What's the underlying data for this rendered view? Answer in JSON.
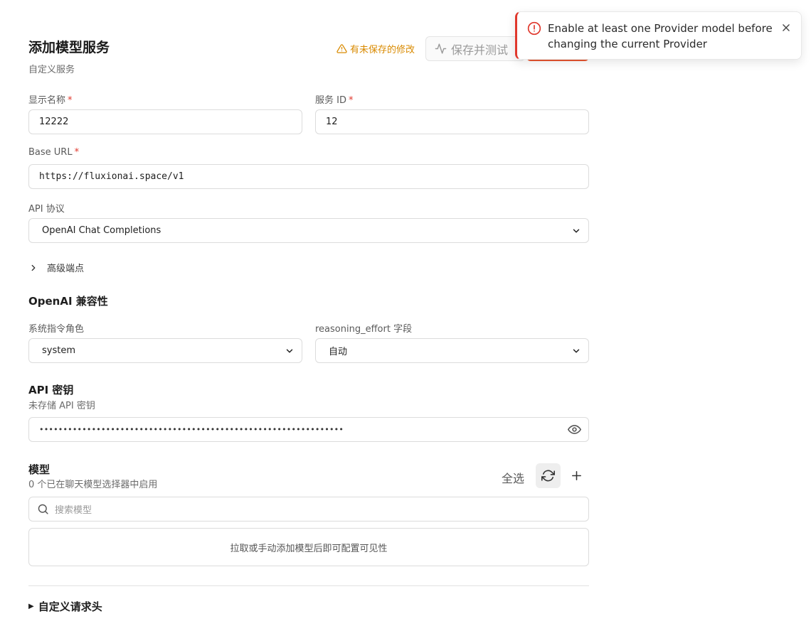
{
  "header": {
    "title": "添加模型服务",
    "subtitle": "自定义服务",
    "unsaved_text": "有未保存的修改",
    "save_test_label": "保存并测试"
  },
  "form": {
    "display_name": {
      "label": "显示名称",
      "required_mark": "*",
      "value": "12222"
    },
    "service_id": {
      "label": "服务 ID",
      "required_mark": "*",
      "value": "12"
    },
    "base_url": {
      "label": "Base URL",
      "required_mark": "*",
      "value": "https://fluxionai.space/v1"
    },
    "api_protocol": {
      "label": "API 协议",
      "selected": "OpenAI Chat Completions"
    },
    "advanced_endpoints": "高级端点"
  },
  "compat": {
    "title": "OpenAI 兼容性",
    "system_role": {
      "label": "系统指令角色",
      "selected": "system"
    },
    "reasoning_effort": {
      "label": "reasoning_effort 字段",
      "selected": "自动"
    }
  },
  "api_key": {
    "title": "API 密钥",
    "subtitle": "未存储 API 密钥",
    "masked_value": "••••••••••••••••••••••••••••••••••••••••••••••••••••••••••••••••"
  },
  "models": {
    "title": "模型",
    "subtitle": "0 个已在聊天模型选择器中启用",
    "select_all": "全选",
    "search_placeholder": "搜索模型",
    "empty_text": "拉取或手动添加模型后即可配置可见性"
  },
  "custom_headers": {
    "label": "自定义请求头"
  },
  "toast": {
    "message": "Enable at least one Provider model before changing the current Provider"
  },
  "colors": {
    "warning": "#d98a00",
    "error": "#e0372c",
    "accent": "#e8552f"
  }
}
